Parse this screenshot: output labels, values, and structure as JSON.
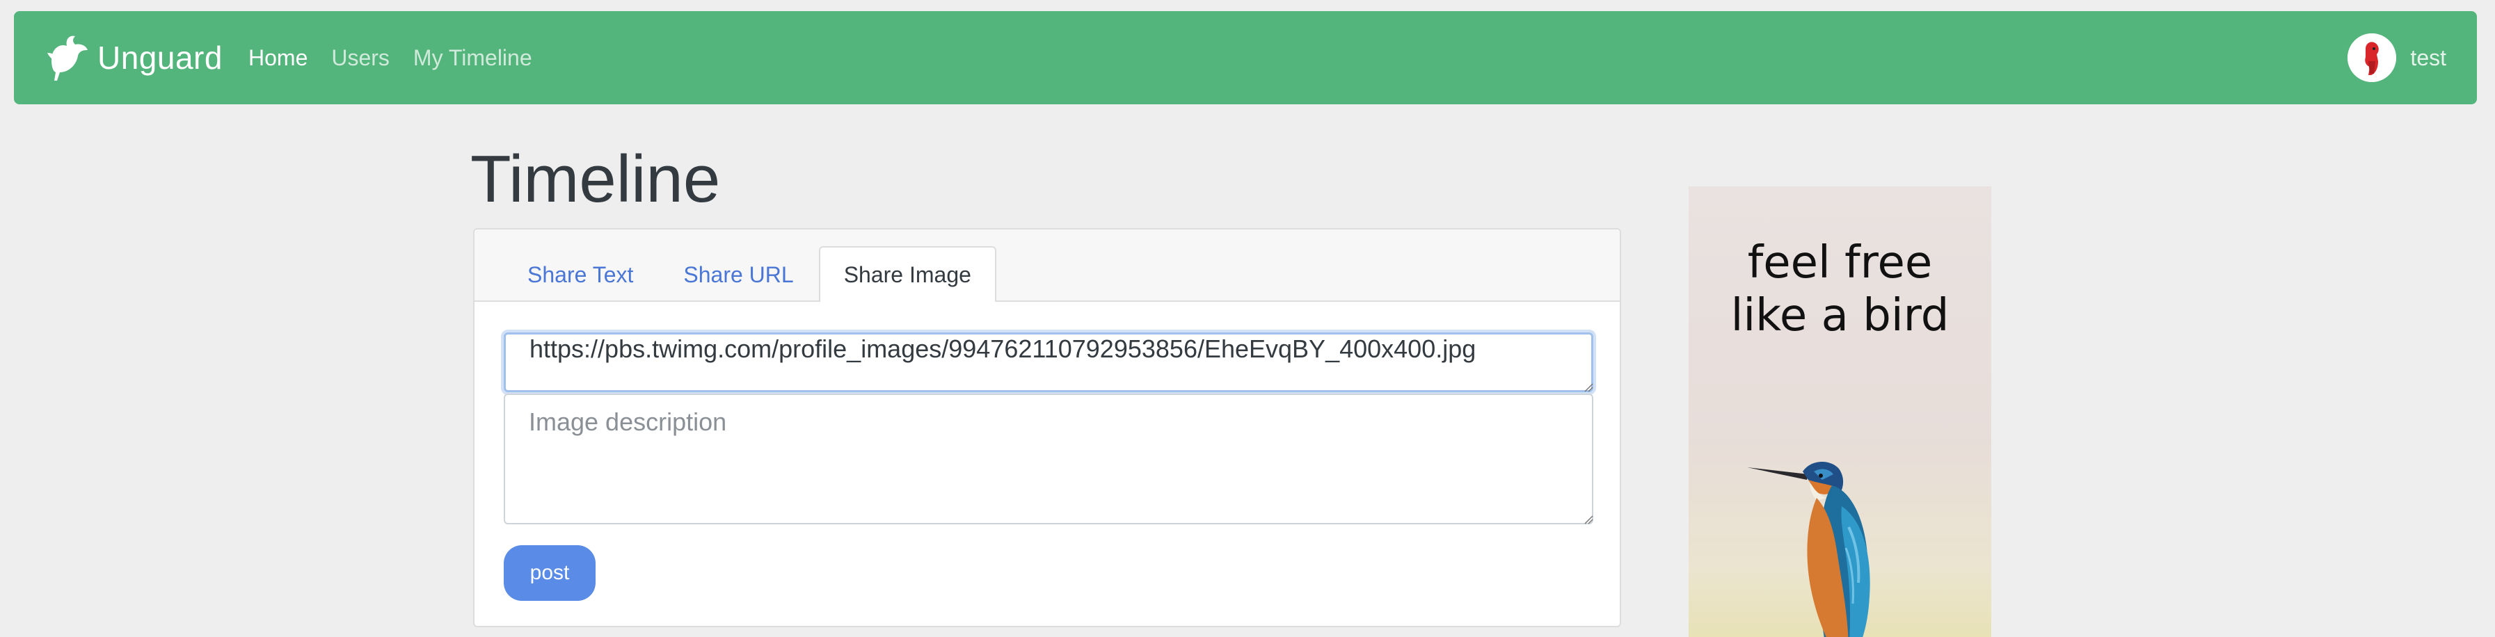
{
  "navbar": {
    "brand": "Unguard",
    "links": [
      "Home",
      "Users",
      "My Timeline"
    ],
    "active_link": "Home",
    "user": "test",
    "colors": {
      "background": "#54b57c",
      "text": "#ffffff"
    }
  },
  "page": {
    "title": "Timeline"
  },
  "composer": {
    "tabs": [
      "Share Text",
      "Share URL",
      "Share Image"
    ],
    "active_tab": "Share Image",
    "image_url_value": "https://pbs.twimg.com/profile_images/994762110792953856/EheEvqBY_400x400.jpg",
    "description_placeholder": "Image description",
    "post_label": "post",
    "colors": {
      "tab_link": "#4a76d6",
      "post_button": "#5a8be6"
    }
  },
  "ad": {
    "line1": "feel free",
    "line2": "like a bird",
    "image": "kingfisher-bird"
  }
}
